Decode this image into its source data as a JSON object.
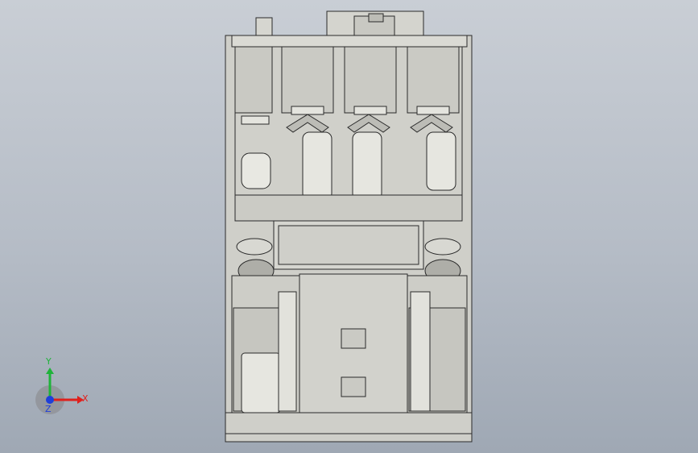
{
  "viewport": {
    "background_top": "#c9ced5",
    "background_bottom": "#9fa8b4",
    "model_body_color": "#d2d2cc",
    "model_edge_color": "#2a2a2a"
  },
  "triad": {
    "x_label": "X",
    "y_label": "Y",
    "z_label": "Z",
    "x_color": "#e0201c",
    "y_color": "#1fb33a",
    "z_color": "#1f3fd9"
  }
}
